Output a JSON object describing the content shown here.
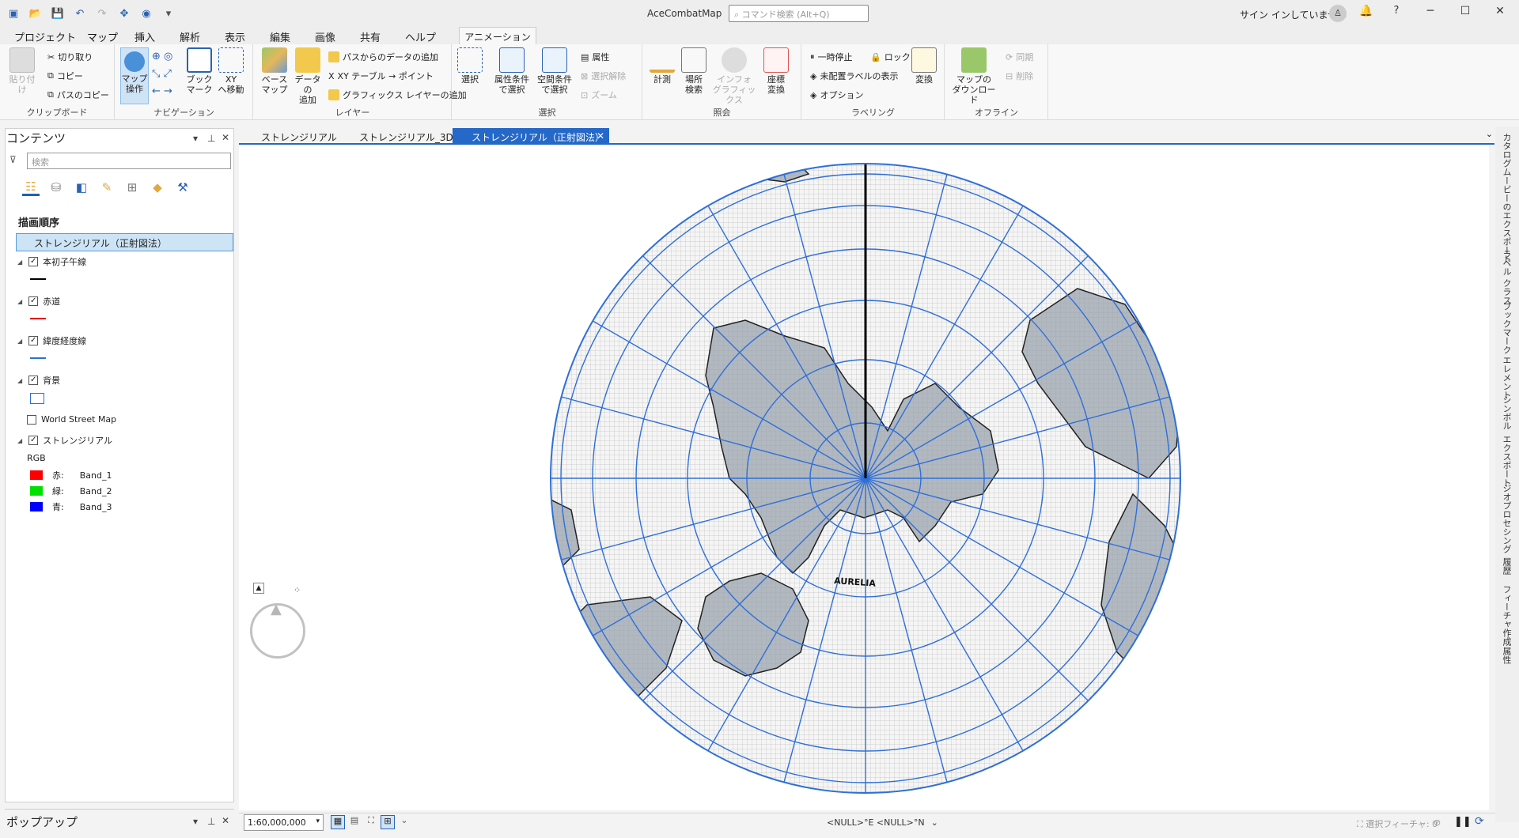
{
  "title_bar": {
    "app_title": "AceCombatMap",
    "command_search_placeholder": "コマンド検索 (Alt+Q)",
    "signin": "サイン インしていません",
    "help": "?"
  },
  "menu": {
    "tabs": [
      "プロジェクト",
      "マップ",
      "挿入",
      "解析",
      "表示",
      "編集",
      "画像",
      "共有",
      "ヘルプ"
    ],
    "active": "マップ",
    "context_tab": "アニメーション"
  },
  "ribbon": {
    "clipboard": {
      "label": "クリップボード",
      "paste": "貼り付け",
      "cut": "切り取り",
      "copy": "コピー",
      "copy_path": "パスのコピー"
    },
    "navigation": {
      "label": "ナビゲーション",
      "explore": "マップ\n操作",
      "bookmarks": "ブック\nマーク",
      "xy": "XY\nへ移動"
    },
    "layer": {
      "label": "レイヤー",
      "basemap": "ベース\nマップ",
      "add_data": "データの\n追加",
      "add_from_path": "パスからのデータの追加",
      "xy_table": "XY テーブル → ポイント",
      "add_graphics": "グラフィックス レイヤーの追加"
    },
    "selection": {
      "label": "選択",
      "select": "選択",
      "by_attr": "属性条件\nで選択",
      "by_location": "空間条件\nで選択",
      "attributes": "属性",
      "clear": "選択解除",
      "zoom": "ズーム"
    },
    "inquiry": {
      "label": "照会",
      "measure": "計測",
      "locate": "場所\n検索",
      "infographics": "インフォ\nグラフィックス",
      "coord_convert": "座標\n変換"
    },
    "labeling": {
      "label": "ラベリング",
      "pause": "一時停止",
      "lock": "ロック",
      "unplaced": "未配置ラベルの表示",
      "options": "オプション",
      "convert": "変換"
    },
    "offline": {
      "label": "オフライン",
      "download": "マップの\nダウンロード",
      "sync": "同期",
      "remove": "削除"
    }
  },
  "contents": {
    "header": "コンテンツ",
    "search_placeholder": "検索",
    "draw_order": "描画順序",
    "map_name": "ストレンジリアル（正射図法）",
    "layers": [
      {
        "name": "本初子午線",
        "checked": true,
        "symbol": "line",
        "color": "#000000"
      },
      {
        "name": "赤道",
        "checked": true,
        "symbol": "line",
        "color": "#e00000"
      },
      {
        "name": "緯度経度線",
        "checked": true,
        "symbol": "line",
        "color": "#2f6fd8"
      },
      {
        "name": "背景",
        "checked": true,
        "symbol": "box",
        "color": "#2f6fd8"
      },
      {
        "name": "World Street Map",
        "checked": false
      },
      {
        "name": "ストレンジリアル",
        "checked": true
      }
    ],
    "raster": {
      "renderer": "RGB",
      "bands": [
        {
          "channel": "赤:",
          "band": "Band_1",
          "color": "#ff0000"
        },
        {
          "channel": "緑:",
          "band": "Band_2",
          "color": "#00e000"
        },
        {
          "channel": "青:",
          "band": "Band_3",
          "color": "#0000ff"
        }
      ]
    }
  },
  "popup_panel": {
    "label": "ポップアップ"
  },
  "doc_tabs": [
    {
      "label": "ストレンジリアル",
      "active": false
    },
    {
      "label": "ストレンジリアル_3D",
      "active": false
    },
    {
      "label": "ストレンジリアル（正射図法）",
      "active": true
    }
  ],
  "map": {
    "overlay_label": "AURELIA",
    "graticule_color": "#2f6fd8",
    "land_color": "#9aa3ad"
  },
  "right_rail": [
    "カタログ",
    "ムービーのエクスポート",
    "ラベル クラス",
    "ブックマーク",
    "エレメント",
    "シンボル",
    "エクスポート",
    "ジオプロセシング",
    "履歴",
    "フィーチャ作成",
    "属性"
  ],
  "status": {
    "scale": "1:60,000,000",
    "coords": "<NULL>°E <NULL>°N",
    "selected_features": "選択フィーチャ: 0"
  }
}
